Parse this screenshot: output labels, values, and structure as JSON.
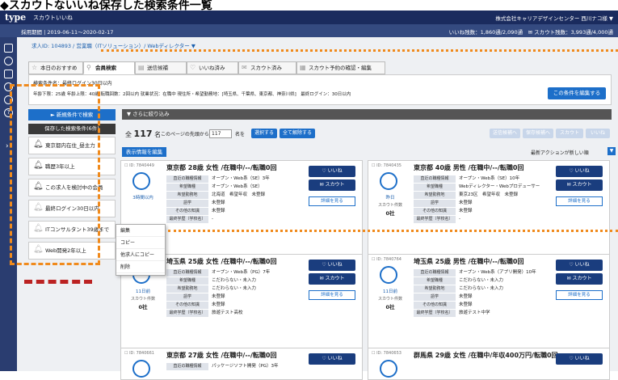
{
  "caption": "◆スカウトないいね保存した検索条件一覧",
  "header": {
    "logo": "type",
    "logo_sub": "スカウトいいね",
    "company": "株式会社キャリアデザインセンター 西川ナコ様 ▼"
  },
  "subbar": {
    "left": "採用期間 | 2019-06-11〜2020-02-17",
    "right": "いいね残数：1,860通/2,090通　✉ スカウト残数：3,993通/4,000通"
  },
  "job_id": "求人ID: 104893 / 営業職（ITソリューション）/ Webディレクター ▼",
  "tabs": [
    "本日のおすすめ",
    "会員検索",
    "送信候補",
    "いいね済み",
    "スカウト済み",
    "スカウト予約の確認・編集"
  ],
  "search": {
    "name": "検索条件名：最終ログイン30日以内",
    "detail": "年齢下限：25歳 年齢上限：40歳 転職回数：2回以内 就業状況：在職中 現住所・希望勤務地：[埼玉県、千葉県、東京都、神奈川県]　最終ログイン：30日以内",
    "save_button": "この条件を編集する"
  },
  "left_panel": {
    "new_button": "► 新規条件で検索",
    "saved_header": "保存した検索条件(6件)",
    "items": [
      "東京都内在住_昼主力",
      "職歴3年以上",
      "この求人を検討中の会員",
      "最終ログイン30日以内",
      "ITコンサルタント39歳まで",
      "Web開発2年以上"
    ]
  },
  "refine_label": "▼ さらに絞り込み",
  "list": {
    "count": "117",
    "count_prefix": "全",
    "count_suffix": "名",
    "page_label": "このページの先頭から",
    "page_value": "117",
    "page_suffix": "名を",
    "select_btn": "選択する",
    "clear_btn": "全て解除する",
    "gray_btns": [
      "送信候補へ",
      "保存候補へ",
      "スカウト",
      "いいね"
    ],
    "edit_btn": "表示情報を編集",
    "sort_label": "最新アクションが新しい順"
  },
  "cards": [
    {
      "id": "ID: 7840449",
      "title": "東京都 28歳 女性 /在職中/--/転職0回",
      "login": "3時間以内",
      "scout_label": "",
      "scout_count": "",
      "rows": [
        [
          "直近の職種情報",
          "オープン・Web系（SE）3年"
        ],
        [
          "希望職種",
          "オープン・Web系（SE）"
        ],
        [
          "希望勤務地",
          "北海道　希望年収　未登録"
        ],
        [
          "語学",
          "未登録"
        ],
        [
          "その他の知識",
          "未登録"
        ],
        [
          "最終学歴（学校名）",
          "-"
        ]
      ]
    },
    {
      "id": "ID: 7840435",
      "title": "東京都 40歳 男性 /在職中/--/転職0回",
      "login": "昨日",
      "scout_label": "スカウト件数",
      "scout_count": "0社",
      "rows": [
        [
          "直近の職種情報",
          "オープン・Web系（SE）10年"
        ],
        [
          "希望職種",
          "Webディレクター・Webプロデューサー"
        ],
        [
          "希望勤務地",
          "東京23区　希望年収　未登録"
        ],
        [
          "語学",
          "未登録"
        ],
        [
          "その他の知識",
          "未登録"
        ],
        [
          "最終学歴（学校名）",
          "-"
        ]
      ]
    },
    {
      "id": "ID: 7840781",
      "title": "埼玉県 25歳 女性 /在職中/--/転職0回",
      "login": "11日前",
      "scout_label": "スカウト件数",
      "scout_count": "0社",
      "rows": [
        [
          "直近の職種情報",
          "オープン・Web系（PG）7年"
        ],
        [
          "希望職種",
          "こだわらない・未入力"
        ],
        [
          "希望勤務地",
          "こだわらない・未入力"
        ],
        [
          "語学",
          "未登録"
        ],
        [
          "その他の知識",
          "未登録"
        ],
        [
          "最終学歴（学校名）",
          "旅遊テスト高校"
        ]
      ]
    },
    {
      "id": "ID: 7840764",
      "title": "埼玉県 25歳 男性 /在職中/--/転職0回",
      "login": "11日前",
      "scout_label": "スカウト件数",
      "scout_count": "0社",
      "rows": [
        [
          "直近の職種情報",
          "オープン・Web系（アプリ開発）10年"
        ],
        [
          "希望職種",
          "こだわらない・未入力"
        ],
        [
          "希望勤務地",
          "こだわらない・未入力"
        ],
        [
          "語学",
          "未登録"
        ],
        [
          "その他の知識",
          "未登録"
        ],
        [
          "最終学歴（学校名）",
          "旅遊テスト中学"
        ]
      ]
    },
    {
      "id": "ID: 7840661",
      "title": "東京都 27歳 女性 /在職中/--/転職0回",
      "login": "",
      "scout_label": "",
      "scout_count": "",
      "rows": [
        [
          "直近の職種情報",
          "パッケージソフト開発（PG）3年"
        ]
      ]
    },
    {
      "id": "ID: 7840653",
      "title": "群馬県 29歳 女性 /在職中/年収400万円/転職0回",
      "login": "",
      "scout_label": "",
      "scout_count": "",
      "rows": []
    }
  ],
  "card_buttons": {
    "like": "♡ いいね",
    "scout": "✉ スカウト",
    "detail": "詳細を見る"
  },
  "popup": [
    "編集",
    "コピー",
    "他求人にコピー",
    "削除"
  ]
}
